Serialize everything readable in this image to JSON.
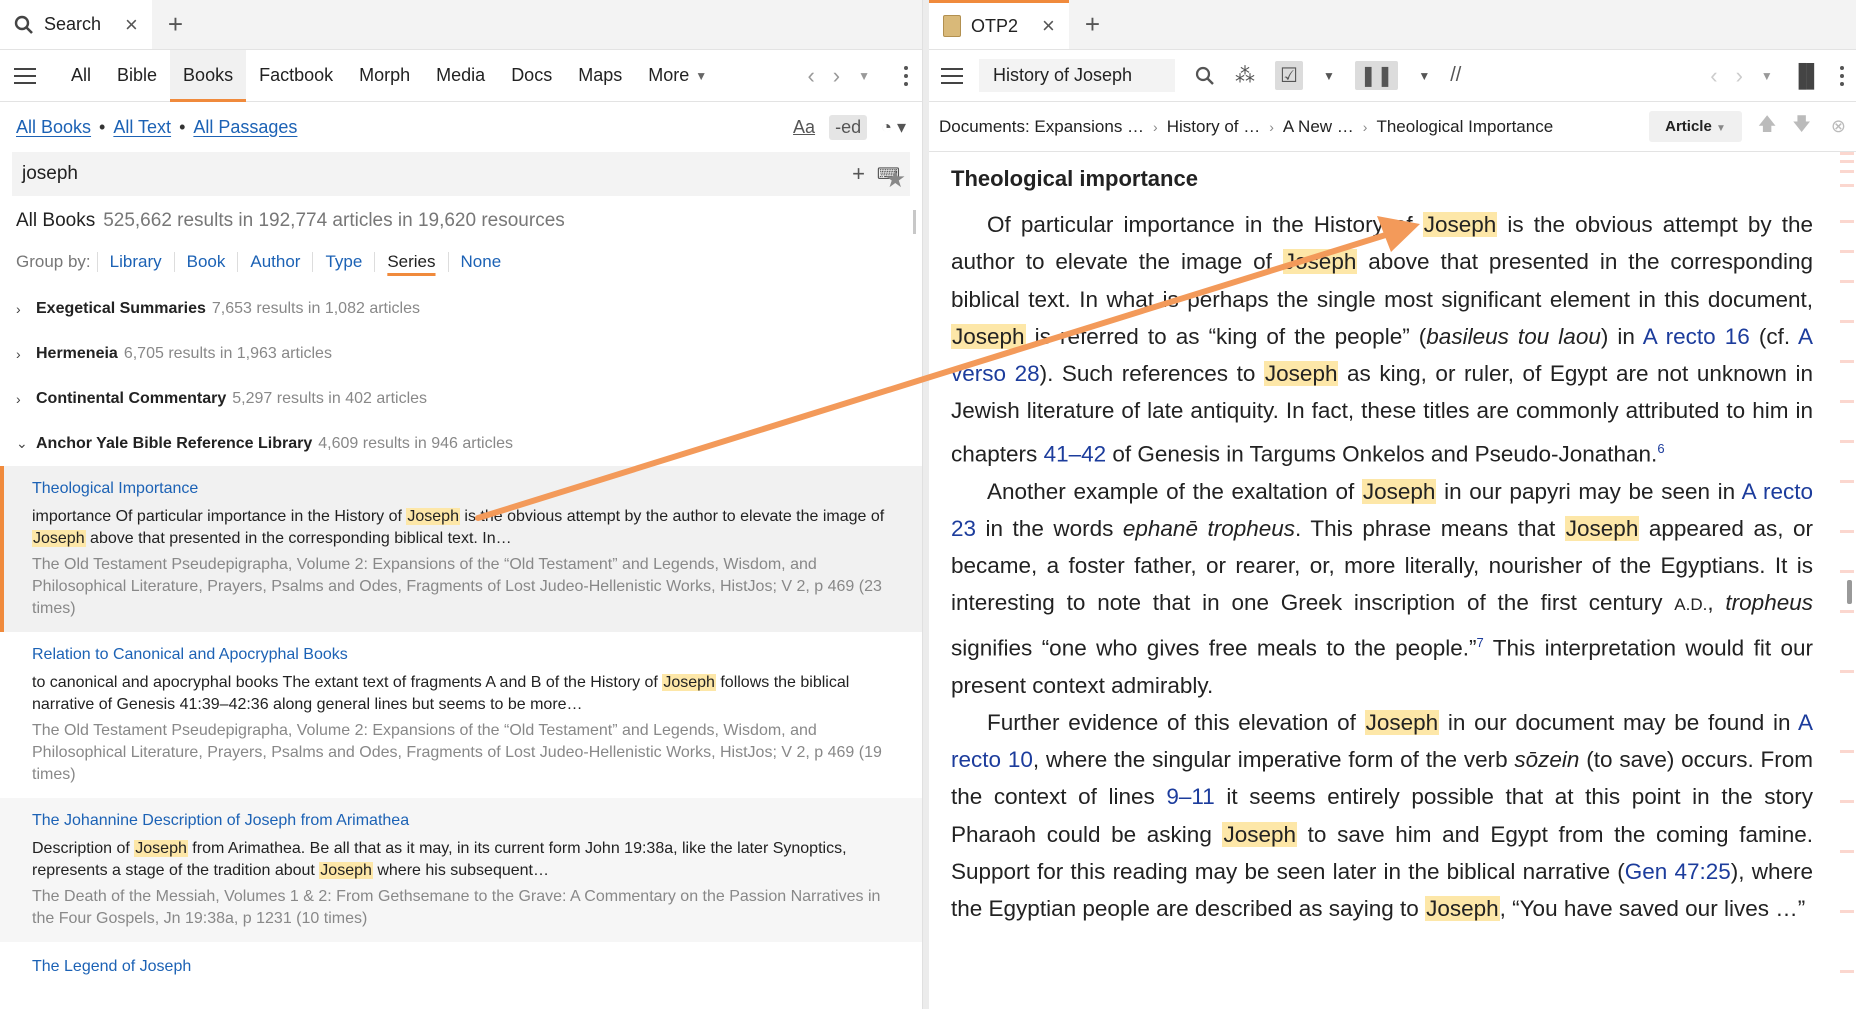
{
  "left": {
    "tab": {
      "label": "Search"
    },
    "nav": [
      "All",
      "Bible",
      "Books",
      "Factbook",
      "Morph",
      "Media",
      "Docs",
      "Maps",
      "More"
    ],
    "scope": {
      "all_books": "All Books",
      "all_text": "All Text",
      "all_passages": "All Passages",
      "aa": "Aa",
      "ed": "-ed"
    },
    "query": "joseph",
    "summary": {
      "label": "All Books",
      "detail": "525,662 results in 192,774 articles in 19,620 resources"
    },
    "groupby": {
      "label": "Group by:",
      "options": [
        "Library",
        "Book",
        "Author",
        "Type",
        "Series",
        "None"
      ]
    },
    "groups": [
      {
        "name": "Exegetical Summaries",
        "count": "7,653 results in 1,082 articles",
        "chev": "›"
      },
      {
        "name": "Hermeneia",
        "count": "6,705 results in 1,963 articles",
        "chev": "›"
      },
      {
        "name": "Continental Commentary",
        "count": "5,297 results in 402 articles",
        "chev": "›"
      },
      {
        "name": "Anchor Yale Bible Reference Library",
        "count": "4,609 results in 946 articles",
        "chev": "⌄"
      }
    ],
    "results": [
      {
        "title": "Theological Importance",
        "s1": "importance Of particular importance in the History of ",
        "h1": "Joseph",
        "s2": " is the obvious attempt by the author to elevate the image of ",
        "h2": "Joseph",
        "s3": " above that presented in the corresponding biblical text. In…",
        "src": "The Old Testament Pseudepigrapha, Volume 2: Expansions of the “Old Testament” and Legends, Wisdom, and Philosophical Literature, Prayers, Psalms and Odes, Fragments of Lost Judeo-Hellenistic Works, HistJos; V 2, p 469 (23 times)"
      },
      {
        "title": "Relation to Canonical and Apocryphal Books",
        "s1": "to canonical and apocryphal books The extant text of fragments A and B of the History of ",
        "h1": "Joseph",
        "s2": " follows the biblical narrative of Genesis 41:39–42:36 along general lines but seems to be more…",
        "h2": "",
        "s3": "",
        "src": "The Old Testament Pseudepigrapha, Volume 2: Expansions of the “Old Testament” and Legends, Wisdom, and Philosophical Literature, Prayers, Psalms and Odes, Fragments of Lost Judeo-Hellenistic Works, HistJos; V 2, p 469 (19 times)"
      },
      {
        "title": "The Johannine Description of Joseph from Arimathea",
        "s1": "Description of ",
        "h1": "Joseph",
        "s2": " from Arimathea. Be all that as it may, in its current form John 19:38a, like the later Synoptics, represents a stage of the tradition about ",
        "h2": "Joseph",
        "s3": " where his subsequent…",
        "src": "The Death of the Messiah, Volumes 1 & 2: From Gethsemane to the Grave: A Commentary on the Passion Narratives in the Four Gospels, Jn 19:38a, p 1231 (10 times)"
      },
      {
        "title": "The Legend of Joseph"
      }
    ]
  },
  "right": {
    "tab": {
      "label": "OTP2"
    },
    "resource": "History of Joseph",
    "breadcrumb": [
      "Documents: Expansions …",
      "History of …",
      "A New …",
      "Theological Importance"
    ],
    "article_btn": "Article",
    "heading": "Theological importance",
    "p1": {
      "a": "Of particular importance in the History of ",
      "b": " is the obvious attempt by the author to elevate the image of ",
      "c": " above that presented in the corresponding biblical text. In what is perhaps the single most significant element in this document, ",
      "d": " is referred to as “king of the people” (",
      "e": "basileus tou laou",
      "f": ") in ",
      "g": "A recto 16",
      "h": " (cf. ",
      "i": "A verso 28",
      "j": "). Such references to ",
      "k": " as king, or ruler, of Egypt are not unknown in Jewish literature of late antiquity. In fact, these titles are commonly attributed to him in chapters ",
      "l": "41–42",
      "m": " of Genesis in Targums Onkelos and Pseudo-Jonathan.",
      "fn": "6"
    },
    "p2": {
      "a": "Another example of the exaltation of ",
      "b": " in our papyri may be seen in ",
      "c": "A recto 23",
      "d": " in the words ",
      "e": "ephanē tropheus",
      "f": ". This phrase means that ",
      "g": " appeared as, or became, a foster father, or rearer, or, more literally, nourisher of the Egyptians. It is interesting to note that in one Greek inscription of the first century ",
      "ad": "A.D.",
      "h": ", ",
      "i": "tropheus",
      "j": " signifies “one who gives free meals to the people.”",
      "fn": "7",
      "k": " This interpretation would fit our present context admirably."
    },
    "p3": {
      "a": "Further evidence of this elevation of ",
      "b": " in our document may be found in ",
      "c": "A recto 10",
      "d": ", where the singular imperative form of the verb ",
      "e": "sōzein",
      "f": " (to save) occurs. From the context of lines ",
      "g": "9–11",
      "h": " it seems entirely possible that at this point in the story Pharaoh could be asking ",
      "i": " to save him and Egypt from the coming famine. Support for this reading may be seen later in the biblical narrative (",
      "j": "Gen 47:25",
      "k": "), where the Egyptian people are described as saying to ",
      "l": ", “You have saved our lives …”"
    },
    "name": "Joseph"
  },
  "colors": {
    "accent": "#f08a3c",
    "link": "#1c62b5",
    "highlight": "#fde7a8"
  }
}
